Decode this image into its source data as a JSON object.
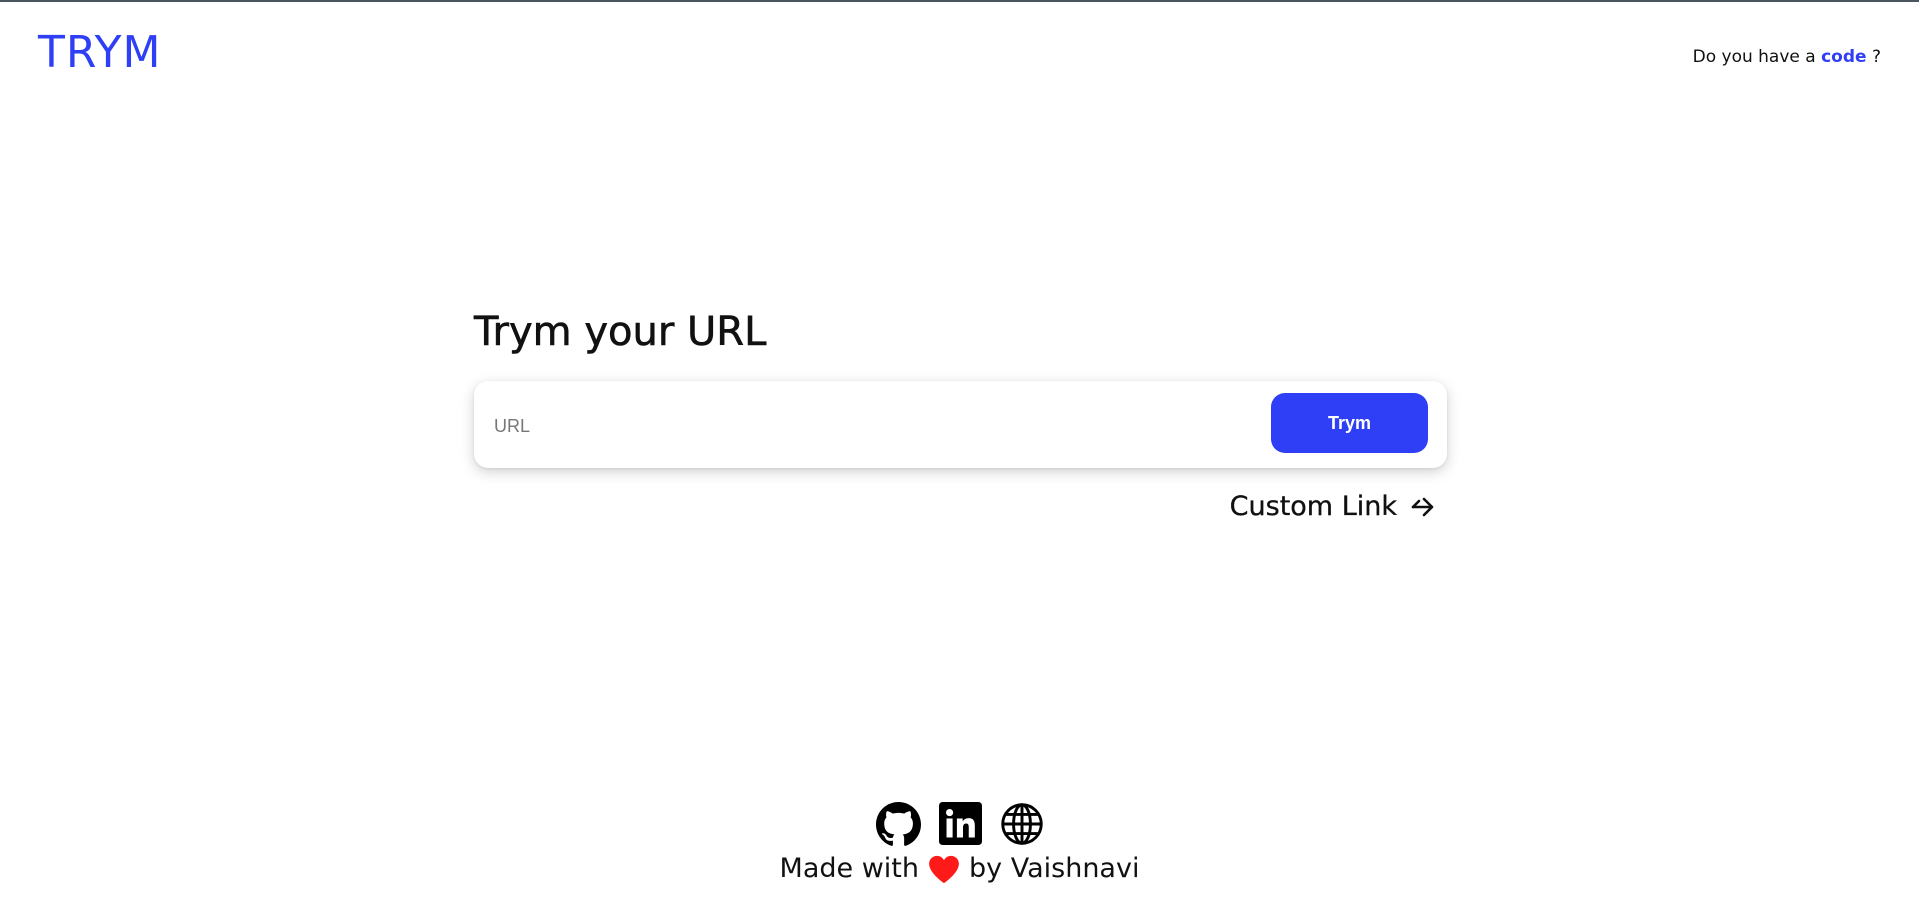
{
  "header": {
    "logo": "TRYM",
    "code_prompt_prefix": "Do you have a",
    "code_link_label": "code",
    "code_prompt_suffix": "?"
  },
  "main": {
    "heading": "Trym your URL",
    "url_input": {
      "value": "",
      "placeholder": "URL"
    },
    "submit_label": "Trym",
    "custom_link_label": "Custom Link"
  },
  "footer": {
    "social_icons": [
      "github-icon",
      "linkedin-icon",
      "globe-icon"
    ],
    "made_with_prefix": "Made with",
    "made_with_suffix": "by Vaishnavi",
    "heart_color": "#ff1a1a"
  },
  "colors": {
    "accent": "#2f3ff5",
    "text": "#111111",
    "background": "#ffffff"
  }
}
